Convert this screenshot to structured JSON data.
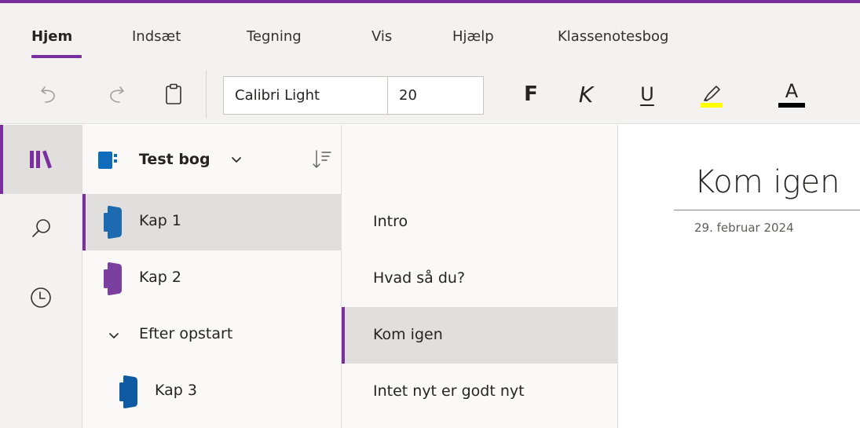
{
  "ribbon": {
    "tabs": [
      {
        "label": "Hjem",
        "active": true
      },
      {
        "label": "Indsæt"
      },
      {
        "label": "Tegning"
      },
      {
        "label": "Vis"
      },
      {
        "label": "Hjælp"
      },
      {
        "label": "Klassenotesbog"
      }
    ],
    "font_name": "Calibri Light",
    "font_size": "20",
    "bold_label": "F",
    "italic_label": "K",
    "underline_label": "U",
    "font_color_label": "A",
    "icons": [
      "undo-icon",
      "redo-icon",
      "clipboard-icon",
      "highlighter-icon",
      "font-color-icon"
    ],
    "highlight_color": "#ffff00",
    "font_color": "#000000"
  },
  "rail": {
    "items": [
      "notebooks-icon",
      "search-icon",
      "recent-icon"
    ],
    "accent": "#7b2f9e"
  },
  "notebook": {
    "title": "Test bog",
    "sections": [
      {
        "label": "Kap 1",
        "color": "#1e6ab0",
        "active": true
      },
      {
        "label": "Kap 2",
        "color": "#7b3fa0"
      },
      {
        "label": "Efter opstart",
        "group": true
      },
      {
        "label": "Kap 3",
        "color": "#0f5ba3",
        "indented": true
      }
    ]
  },
  "pages": [
    {
      "label": "Intro"
    },
    {
      "label": "Hvad så du?"
    },
    {
      "label": "Kom igen",
      "active": true
    },
    {
      "label": "Intet nyt er godt nyt"
    }
  ],
  "canvas": {
    "title": "Kom igen",
    "date": "29. februar 2024"
  }
}
